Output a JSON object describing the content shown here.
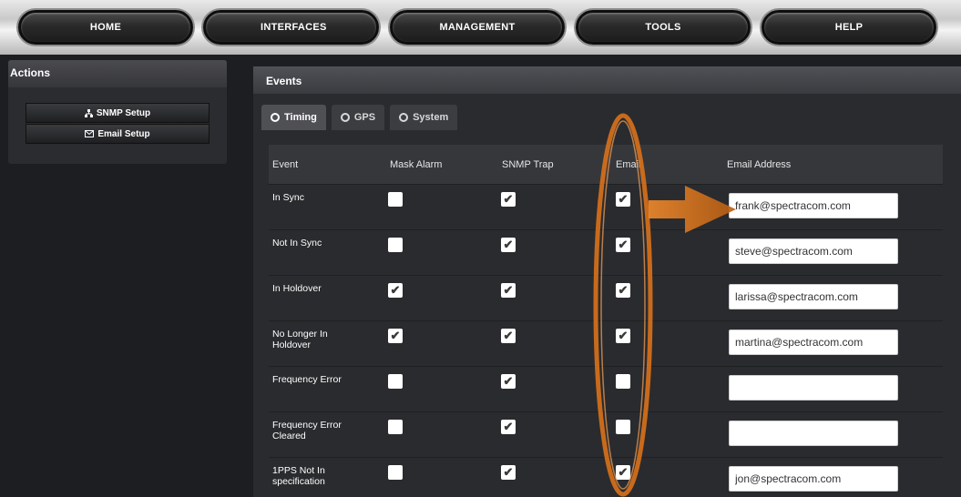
{
  "nav": {
    "home": "HOME",
    "interfaces": "INTERFACES",
    "management": "MANAGEMENT",
    "tools": "TOOLS",
    "help": "HELP"
  },
  "actions": {
    "title": "Actions",
    "snmp_setup": "SNMP Setup",
    "email_setup": "Email Setup"
  },
  "events": {
    "title": "Events",
    "tabs": [
      {
        "label": "Timing",
        "active": true
      },
      {
        "label": "GPS",
        "active": false
      },
      {
        "label": "System",
        "active": false
      }
    ],
    "columns": [
      "Event",
      "Mask Alarm",
      "SNMP Trap",
      "Email",
      "Email Address"
    ],
    "rows": [
      {
        "event": "In Sync",
        "mask_alarm": false,
        "snmp_trap": true,
        "email": true,
        "email_address": "frank@spectracom.com"
      },
      {
        "event": "Not In Sync",
        "mask_alarm": false,
        "snmp_trap": true,
        "email": true,
        "email_address": "steve@spectracom.com"
      },
      {
        "event": "In Holdover",
        "mask_alarm": true,
        "snmp_trap": true,
        "email": true,
        "email_address": "larissa@spectracom.com"
      },
      {
        "event": "No Longer In Holdover",
        "mask_alarm": true,
        "snmp_trap": true,
        "email": true,
        "email_address": "martina@spectracom.com"
      },
      {
        "event": "Frequency Error",
        "mask_alarm": false,
        "snmp_trap": true,
        "email": false,
        "email_address": ""
      },
      {
        "event": "Frequency Error Cleared",
        "mask_alarm": false,
        "snmp_trap": true,
        "email": false,
        "email_address": ""
      },
      {
        "event": "1PPS Not In specification",
        "mask_alarm": false,
        "snmp_trap": true,
        "email": true,
        "email_address": "jon@spectracom.com"
      }
    ]
  },
  "colors": {
    "annotation": "#e0761c",
    "panel_bg": "#2a2b2e",
    "header_bg": "#36373b"
  }
}
